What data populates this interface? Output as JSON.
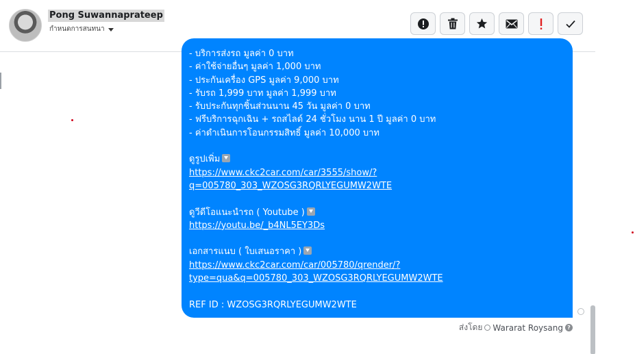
{
  "header": {
    "contact_name": "Pong Suwannaprateep",
    "subtitle": "กำหนดการสนทนา",
    "subtitle_icon": "caret-down-icon",
    "toolbar": [
      {
        "name": "mark-spam-button",
        "icon": "exclamation-circle-icon"
      },
      {
        "name": "delete-button",
        "icon": "trash-icon"
      },
      {
        "name": "star-button",
        "icon": "star-icon"
      },
      {
        "name": "mark-unread-button",
        "icon": "envelope-icon"
      },
      {
        "name": "follow-up-button",
        "icon": "exclamation-icon",
        "color": "#e02020"
      },
      {
        "name": "mark-done-button",
        "icon": "check-icon"
      }
    ]
  },
  "message": {
    "bubble_color": "#0084ff",
    "lines": [
      "- บริการส่งรถ     มูลค่า 0 บาท",
      "- ค่าใช้จ่ายอื่นๆ     มูลค่า 1,000 บาท",
      "- ประกันเครื่อง GPS     มูลค่า 9,000 บาท",
      "- รับรถ 1,999 บาท     มูลค่า 1,999 บาท",
      "- รับประกันทุกชิ้นส่วนนาน 45 วัน     มูลค่า 0 บาท",
      "- ฟรีบริการฉุกเฉิน + รถสไลด์ 24 ชั่วโมง นาน 1 ปี     มูลค่า 0 บาท",
      "- ค่าดำเนินการโอนกรรมสิทธิ์     มูลค่า 10,000 บาท"
    ],
    "photos_label": "ดูรูปเพิ่ม",
    "photos_link_1": "https://www.ckc2car.com/car/3555/show/?",
    "photos_link_2": "q=005780_303_WZOSG3RQRLYEGUMW2WTE",
    "video_label": "ดูวีดีโอแนะนำรถ ( Youtube )",
    "video_link": "https://youtu.be/_b4NL5EY3Ds",
    "doc_label": "เอกสารแนบ ( ใบเสนอราคา )",
    "doc_link_1": "https://www.ckc2car.com/car/005780/qrender/?",
    "doc_link_2": "type=qua&q=005780_303_WZOSG3RQRLYEGUMW2WTE",
    "ref_id": "REF ID : WZOSG3RQRLYEGUMW2WTE",
    "emoji_icon": "down-arrow-icon"
  },
  "footer": {
    "sent_by_label": "ส่งโดย",
    "sender_name": "Wararat Roysang"
  }
}
